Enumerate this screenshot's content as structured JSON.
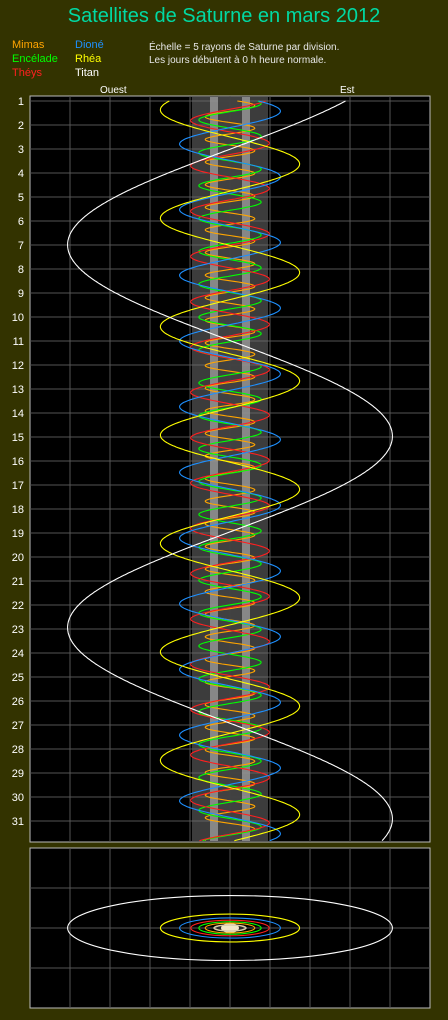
{
  "title": "Satellites de Saturne en mars 2012",
  "legend": [
    {
      "name": "Mimas",
      "color": "#ffa500"
    },
    {
      "name": "Encélade",
      "color": "#00ff00"
    },
    {
      "name": "Théys",
      "color": "#ff2020"
    },
    {
      "name": "Dioné",
      "color": "#1e90ff"
    },
    {
      "name": "Rhéa",
      "color": "#ffff00"
    },
    {
      "name": "Titan",
      "color": "#ffffff"
    }
  ],
  "note": {
    "line1": "Échelle = 5 rayons de Saturne par division.",
    "line2": "Les jours débutent à 0 h heure normale."
  },
  "direction": {
    "west": "Ouest",
    "east": "Est"
  },
  "chart_data": {
    "type": "line",
    "title": "Satellites de Saturne en mars 2012",
    "xlabel": "",
    "ylabel": "",
    "x_unit_per_division": 5,
    "xlim_divisions": [
      -5,
      5
    ],
    "days": [
      "1",
      "2",
      "3",
      "4",
      "5",
      "6",
      "7",
      "8",
      "9",
      "10",
      "11",
      "12",
      "13",
      "14",
      "15",
      "16",
      "17",
      "18",
      "19",
      "20",
      "21",
      "22",
      "23",
      "24",
      "25",
      "26",
      "27",
      "28",
      "29",
      "30",
      "31"
    ],
    "grid": true,
    "series": [
      {
        "name": "Mimas",
        "color": "#ffa500",
        "amplitude_radii": 3.1,
        "period_days": 0.942,
        "phase": 0.3
      },
      {
        "name": "Encélade",
        "color": "#00ff00",
        "amplitude_radii": 3.9,
        "period_days": 1.37,
        "phase": 1.1
      },
      {
        "name": "Théys",
        "color": "#ff2020",
        "amplitude_radii": 4.9,
        "period_days": 1.888,
        "phase": 2.0
      },
      {
        "name": "Dioné",
        "color": "#1e90ff",
        "amplitude_radii": 6.3,
        "period_days": 2.737,
        "phase": 0.6
      },
      {
        "name": "Rhéa",
        "color": "#ffff00",
        "amplitude_radii": 8.7,
        "period_days": 4.518,
        "phase": 4.2
      },
      {
        "name": "Titan",
        "color": "#ffffff",
        "amplitude_radii": 20.3,
        "period_days": 15.945,
        "phase": 2.35
      }
    ]
  }
}
